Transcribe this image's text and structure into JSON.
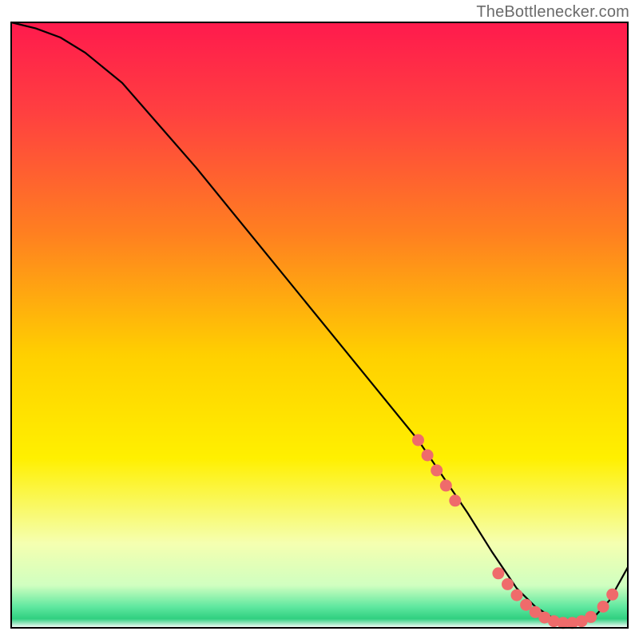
{
  "header": {
    "attribution": "TheBottlenecker.com"
  },
  "chart_data": {
    "type": "line",
    "title": "",
    "xlabel": "",
    "ylabel": "",
    "xlim": [
      0,
      100
    ],
    "ylim": [
      0,
      100
    ],
    "series": [
      {
        "name": "curve",
        "x": [
          0,
          4,
          8,
          12,
          18,
          24,
          30,
          36,
          42,
          48,
          54,
          60,
          66,
          70,
          74,
          78,
          82,
          85,
          88,
          91,
          94,
          97,
          100
        ],
        "y": [
          100,
          99,
          97.5,
          95,
          90,
          83,
          76,
          68.5,
          61,
          53.5,
          46,
          38.5,
          31,
          25,
          19,
          12.5,
          6.5,
          3.5,
          1.5,
          0.8,
          1.2,
          4.5,
          10
        ]
      }
    ],
    "markers": [
      {
        "x": 66,
        "y": 31
      },
      {
        "x": 67.5,
        "y": 28.5
      },
      {
        "x": 69,
        "y": 26
      },
      {
        "x": 70.5,
        "y": 23.5
      },
      {
        "x": 72,
        "y": 21
      },
      {
        "x": 79,
        "y": 9
      },
      {
        "x": 80.5,
        "y": 7.2
      },
      {
        "x": 82,
        "y": 5.4
      },
      {
        "x": 83.5,
        "y": 3.8
      },
      {
        "x": 85,
        "y": 2.6
      },
      {
        "x": 86.5,
        "y": 1.7
      },
      {
        "x": 88,
        "y": 1.1
      },
      {
        "x": 89.5,
        "y": 0.8
      },
      {
        "x": 91,
        "y": 0.8
      },
      {
        "x": 92.5,
        "y": 1.1
      },
      {
        "x": 94,
        "y": 1.8
      },
      {
        "x": 96,
        "y": 3.5
      },
      {
        "x": 97.5,
        "y": 5.5
      }
    ],
    "gradient_stops": [
      {
        "offset": 0.0,
        "color": "#ff1a4d"
      },
      {
        "offset": 0.15,
        "color": "#ff4040"
      },
      {
        "offset": 0.35,
        "color": "#ff8020"
      },
      {
        "offset": 0.55,
        "color": "#ffd000"
      },
      {
        "offset": 0.72,
        "color": "#fff000"
      },
      {
        "offset": 0.86,
        "color": "#f5ffb0"
      },
      {
        "offset": 0.93,
        "color": "#d0ffc0"
      },
      {
        "offset": 0.965,
        "color": "#60e8a0"
      },
      {
        "offset": 0.985,
        "color": "#30d080"
      },
      {
        "offset": 1.0,
        "color": "#ffffff"
      }
    ],
    "marker_color": "#ef6b6b",
    "line_color": "#000000",
    "border_color": "#000000"
  }
}
